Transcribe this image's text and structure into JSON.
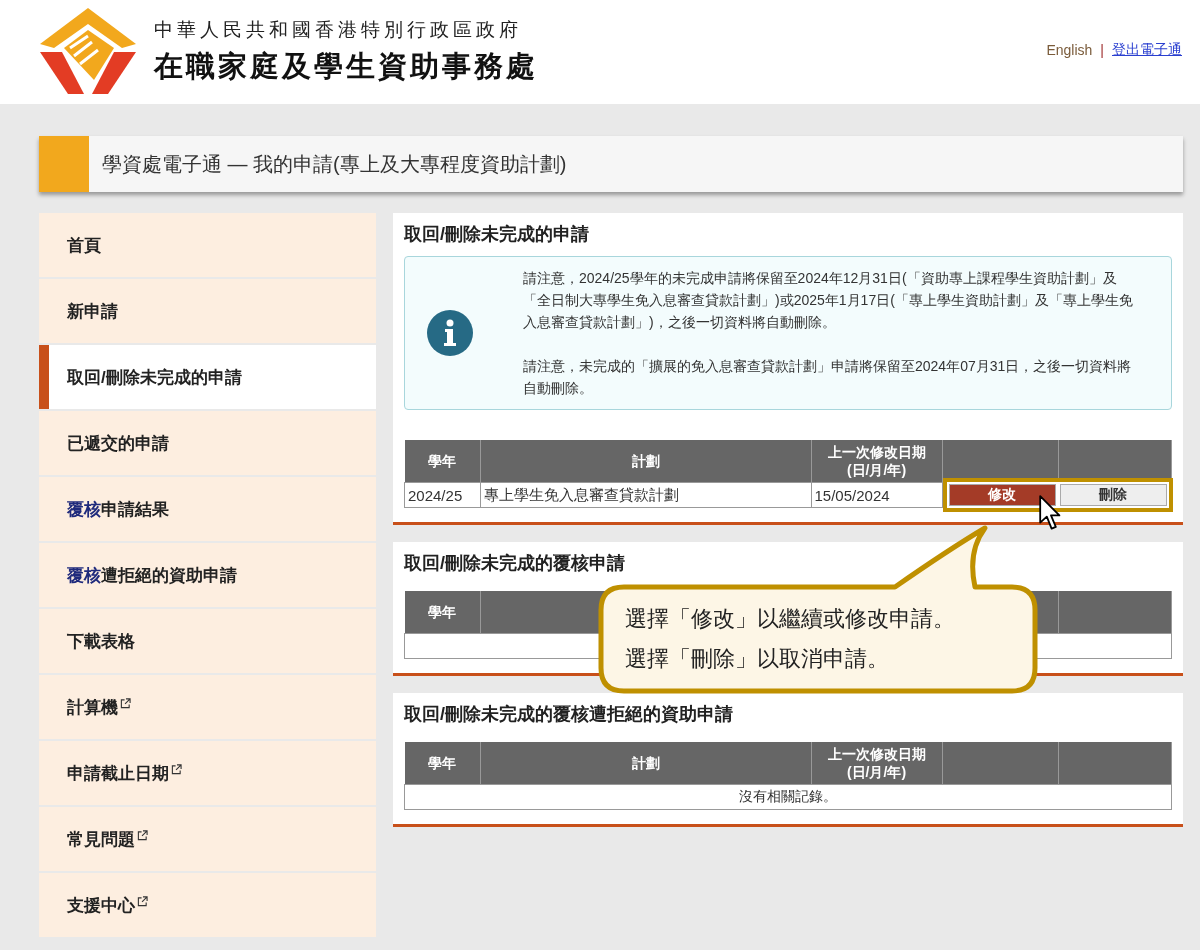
{
  "header": {
    "government": "中華人民共和國香港特別行政區政府",
    "agency": "在職家庭及學生資助事務處",
    "links": [
      {
        "label": "English",
        "kind": "language"
      },
      {
        "label": "登出電子通",
        "kind": "logout"
      }
    ],
    "separator": "|"
  },
  "page_title": "學資處電子通 — 我的申請(專上及大專程度資助計劃)",
  "sidebar": {
    "items": [
      {
        "label": "首頁",
        "selected": false,
        "external": false
      },
      {
        "label": "新申請",
        "selected": false,
        "external": false
      },
      {
        "label": "取回/刪除未完成的申請",
        "selected": true,
        "external": false
      },
      {
        "label": "已遞交的申請",
        "selected": false,
        "external": false
      },
      {
        "lead": "覆核",
        "label": "申請結果",
        "selected": false,
        "external": false
      },
      {
        "lead": "覆核",
        "label": "遭拒絕的資助申請",
        "selected": false,
        "external": false
      },
      {
        "label": "下載表格",
        "selected": false,
        "external": false
      },
      {
        "label": "計算機",
        "selected": false,
        "external": true
      },
      {
        "label": "申請截止日期",
        "selected": false,
        "external": true
      },
      {
        "label": "常見問題",
        "selected": false,
        "external": true
      },
      {
        "label": "支援中心",
        "selected": false,
        "external": true
      }
    ]
  },
  "sections": [
    {
      "title": "取回/刪除未完成的申請",
      "notice": [
        "請注意，2024/25學年的未完成申請將保留至2024年12月31日(「資助專上課程學生資助計劃」及「全日制大專學生免入息審查貸款計劃」)或2025年1月17日(「專上學生資助計劃」及「專上學生免入息審查貸款計劃」)，之後一切資料將自動刪除。",
        "請注意，未完成的「擴展的免入息審查貸款計劃」申請將保留至2024年07月31日，之後一切資料將自動刪除。"
      ],
      "table": {
        "columns": [
          {
            "label": "學年"
          },
          {
            "label": "計劃"
          },
          {
            "label": "上一次修改日期\n(日/月/年)"
          },
          {},
          {}
        ],
        "rows": [
          {
            "year": "2024/25",
            "scheme": "專上學生免入息審查貸款計劃",
            "date": "15/05/2024",
            "actions": [
              {
                "label": "修改",
                "kind": "primary"
              },
              {
                "label": "刪除",
                "kind": "secondary"
              }
            ]
          }
        ]
      }
    },
    {
      "title": "取回/刪除未完成的覆核申請",
      "table": {
        "columns": [
          {
            "label": "學年"
          },
          {},
          {},
          {},
          {}
        ]
      }
    },
    {
      "title": "取回/刪除未完成的覆核遭拒絕的資助申請",
      "table": {
        "columns": [
          {
            "label": "學年"
          },
          {
            "label": "計劃"
          },
          {
            "label": "上一次修改日期\n(日/月/年)"
          },
          {},
          {}
        ],
        "note": "沒有相關記錄。"
      }
    }
  ],
  "callout": {
    "lines": [
      "選擇「修改」以繼續或修改申請。",
      "選擇「刪除」以取消申請。"
    ]
  }
}
